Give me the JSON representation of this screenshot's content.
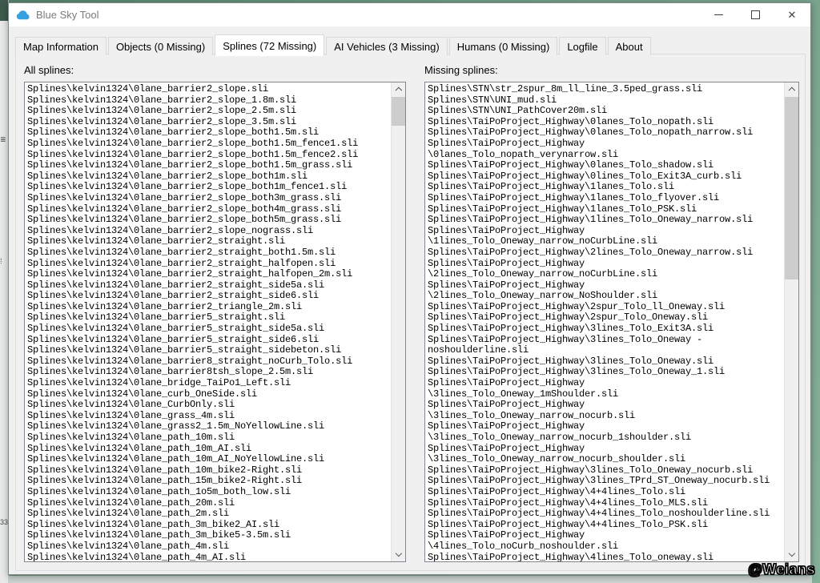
{
  "window": {
    "title": "Blue Sky Tool",
    "controls": {
      "minimize": "minimize",
      "maximize": "maximize",
      "close": "×"
    }
  },
  "colors": {
    "title_icon_blue": "#36a1e0",
    "desktop_green": "#6f9c84",
    "active_tab_bg": "#ffffff",
    "list_border": "#828790",
    "scroll_thumb": "#cdcdcd"
  },
  "tabs": [
    {
      "label": "Map Information",
      "active": false
    },
    {
      "label": "Objects (0 Missing)",
      "active": false
    },
    {
      "label": "Splines (72 Missing)",
      "active": true
    },
    {
      "label": "AI Vehicles (3 Missing)",
      "active": false
    },
    {
      "label": "Humans (0 Missing)",
      "active": false
    },
    {
      "label": "Logfile",
      "active": false
    },
    {
      "label": "About",
      "active": false
    }
  ],
  "panels": {
    "all_splines": {
      "label": "All splines:",
      "items": [
        "Splines\\kelvin1324\\0lane_barrier2_slope.sli",
        "Splines\\kelvin1324\\0lane_barrier2_slope_1.8m.sli",
        "Splines\\kelvin1324\\0lane_barrier2_slope_2.5m.sli",
        "Splines\\kelvin1324\\0lane_barrier2_slope_3.5m.sli",
        "Splines\\kelvin1324\\0lane_barrier2_slope_both1.5m.sli",
        "Splines\\kelvin1324\\0lane_barrier2_slope_both1.5m_fence1.sli",
        "Splines\\kelvin1324\\0lane_barrier2_slope_both1.5m_fence2.sli",
        "Splines\\kelvin1324\\0lane_barrier2_slope_both1.5m_grass.sli",
        "Splines\\kelvin1324\\0lane_barrier2_slope_both1m.sli",
        "Splines\\kelvin1324\\0lane_barrier2_slope_both1m_fence1.sli",
        "Splines\\kelvin1324\\0lane_barrier2_slope_both3m_grass.sli",
        "Splines\\kelvin1324\\0lane_barrier2_slope_both4m_grass.sli",
        "Splines\\kelvin1324\\0lane_barrier2_slope_both5m_grass.sli",
        "Splines\\kelvin1324\\0lane_barrier2_slope_nograss.sli",
        "Splines\\kelvin1324\\0lane_barrier2_straight.sli",
        "Splines\\kelvin1324\\0lane_barrier2_straight_both1.5m.sli",
        "Splines\\kelvin1324\\0lane_barrier2_straight_halfopen.sli",
        "Splines\\kelvin1324\\0lane_barrier2_straight_halfopen_2m.sli",
        "Splines\\kelvin1324\\0lane_barrier2_straight_side5a.sli",
        "Splines\\kelvin1324\\0lane_barrier2_straight_side6.sli",
        "Splines\\kelvin1324\\0lane_barrier2_triangle_2m.sli",
        "Splines\\kelvin1324\\0lane_barrier5_straight.sli",
        "Splines\\kelvin1324\\0lane_barrier5_straight_side5a.sli",
        "Splines\\kelvin1324\\0lane_barrier5_straight_side6.sli",
        "Splines\\kelvin1324\\0lane_barrier5_straight_sidebeton.sli",
        "Splines\\kelvin1324\\0lane_barrier8_straight_noCurb_Tolo.sli",
        "Splines\\kelvin1324\\0lane_barrier8tsh_slope_2.5m.sli",
        "Splines\\kelvin1324\\0lane_bridge_TaiPo1_Left.sli",
        "Splines\\kelvin1324\\0lane_curb_OneSide.sli",
        "Splines\\kelvin1324\\0lane_CurbOnly.sli",
        "Splines\\kelvin1324\\0lane_grass_4m.sli",
        "Splines\\kelvin1324\\0lane_grass2_1.5m_NoYellowLine.sli",
        "Splines\\kelvin1324\\0lane_path_10m.sli",
        "Splines\\kelvin1324\\0lane_path_10m_AI.sli",
        "Splines\\kelvin1324\\0lane_path_10m_AI_NoYellowLine.sli",
        "Splines\\kelvin1324\\0lane_path_10m_bike2-Right.sli",
        "Splines\\kelvin1324\\0lane_path_15m_bike2-Right.sli",
        "Splines\\kelvin1324\\0lane_path_1o5m_both_low.sli",
        "Splines\\kelvin1324\\0lane_path_20m.sli",
        "Splines\\kelvin1324\\0lane_path_2m.sli",
        "Splines\\kelvin1324\\0lane_path_3m_bike2_AI.sli",
        "Splines\\kelvin1324\\0lane_path_3m_bike5-3.5m.sli",
        "Splines\\kelvin1324\\0lane_path_4m.sli",
        "Splines\\kelvin1324\\0lane_path_4m_AI.sli"
      ]
    },
    "missing_splines": {
      "label": "Missing splines:",
      "items": [
        "Splines\\STN\\str_2spur_8m_ll_line_3.5ped_grass.sli",
        "Splines\\STN\\UNI_mud.sli",
        "Splines\\STN\\UNI_PathCover20m.sli",
        "Splines\\TaiPoProject_Highway\\0lanes_Tolo_nopath.sli",
        "Splines\\TaiPoProject_Highway\\0lanes_Tolo_nopath_narrow.sli",
        "Splines\\TaiPoProject_Highway",
        "\\0lanes_Tolo_nopath_verynarrow.sli",
        "Splines\\TaiPoProject_Highway\\0lanes_Tolo_shadow.sli",
        "Splines\\TaiPoProject_Highway\\0lines_Tolo_Exit3A_curb.sli",
        "Splines\\TaiPoProject_Highway\\1lanes_Tolo.sli",
        "Splines\\TaiPoProject_Highway\\1lanes_Tolo_flyover.sli",
        "Splines\\TaiPoProject_Highway\\1lanes_Tolo_PSK.sli",
        "Splines\\TaiPoProject_Highway\\1lines_Tolo_Oneway_narrow.sli",
        "Splines\\TaiPoProject_Highway",
        "\\1lines_Tolo_Oneway_narrow_noCurbLine.sli",
        "Splines\\TaiPoProject_Highway\\2lines_Tolo_Oneway_narrow.sli",
        "Splines\\TaiPoProject_Highway",
        "\\2lines_Tolo_Oneway_narrow_noCurbLine.sli",
        "Splines\\TaiPoProject_Highway",
        "\\2lines_Tolo_Oneway_narrow_NoShoulder.sli",
        "Splines\\TaiPoProject_Highway\\2spur_Tolo_ll_Oneway.sli",
        "Splines\\TaiPoProject_Highway\\2spur_Tolo_Oneway.sli",
        "Splines\\TaiPoProject_Highway\\3lines_Tolo_Exit3A.sli",
        "Splines\\TaiPoProject_Highway\\3lines_Tolo_Oneway -",
        "noshoulderline.sli",
        "Splines\\TaiPoProject_Highway\\3lines_Tolo_Oneway.sli",
        "Splines\\TaiPoProject_Highway\\3lines_Tolo_Oneway_1.sli",
        "Splines\\TaiPoProject_Highway",
        "\\3lines_Tolo_Oneway_1mShoulder.sli",
        "Splines\\TaiPoProject_Highway",
        "\\3lines_Tolo_Oneway_narrow_nocurb.sli",
        "Splines\\TaiPoProject_Highway",
        "\\3lines_Tolo_Oneway_narrow_nocurb_1shoulder.sli",
        "Splines\\TaiPoProject_Highway",
        "\\3lines_Tolo_Oneway_narrow_nocurb_shoulder.sli",
        "Splines\\TaiPoProject_Highway\\3lines_Tolo_Oneway_nocurb.sli",
        "Splines\\TaiPoProject_Highway\\3lines_TPrd_ST_Oneway_nocurb.sli",
        "Splines\\TaiPoProject_Highway\\4+4lines_Tolo.sli",
        "Splines\\TaiPoProject_Highway\\4+4lines_Tolo_MLS.sli",
        "Splines\\TaiPoProject_Highway\\4+4lines_Tolo_noshoulderline.sli",
        "Splines\\TaiPoProject_Highway\\4+4lines_Tolo_PSK.sli",
        "Splines\\TaiPoProject_Highway",
        "\\4lines_Tolo_noCurb_noshoulder.sli",
        "Splines\\TaiPoProject_Highway\\4lines_Tolo_oneway.sli"
      ]
    }
  },
  "watermark": "@Weians",
  "background_artifacts": {
    "mark_menu": "≣",
    "mark_dots": "⁞",
    "mark_number": "33"
  }
}
